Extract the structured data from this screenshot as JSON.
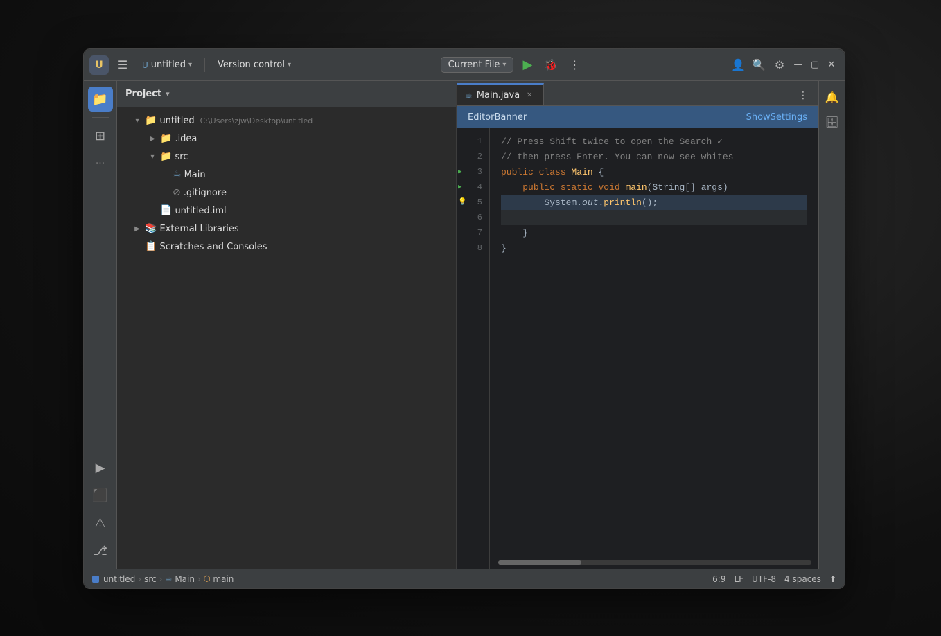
{
  "window": {
    "title": "untitled",
    "logo_letter": "U",
    "project_label": "untitled",
    "project_arrow": "▾",
    "vcs_label": "Version control",
    "vcs_arrow": "▾",
    "run_config_label": "Current File",
    "run_config_arrow": "▾"
  },
  "toolbar": {
    "icons": [
      "📁",
      "⊞",
      "···"
    ]
  },
  "panel": {
    "title": "Project",
    "title_arrow": "▾"
  },
  "file_tree": [
    {
      "indent": 1,
      "arrow": "▾",
      "icon": "📁",
      "icon_class": "folder",
      "name": "untitled",
      "path": "C:\\Users\\zjw\\Desktop\\untitled"
    },
    {
      "indent": 2,
      "arrow": "▶",
      "icon": "📁",
      "icon_class": "folder",
      "name": ".idea",
      "path": ""
    },
    {
      "indent": 2,
      "arrow": "▾",
      "icon": "📁",
      "icon_class": "folder",
      "name": "src",
      "path": ""
    },
    {
      "indent": 3,
      "arrow": "",
      "icon": "☕",
      "icon_class": "java",
      "name": "Main",
      "path": ""
    },
    {
      "indent": 3,
      "arrow": "",
      "icon": "⊘",
      "icon_class": "git",
      "name": ".gitignore",
      "path": ""
    },
    {
      "indent": 2,
      "arrow": "",
      "icon": "📄",
      "icon_class": "file",
      "name": "untitled.iml",
      "path": ""
    },
    {
      "indent": 1,
      "arrow": "▶",
      "icon": "📚",
      "icon_class": "folder",
      "name": "External Libraries",
      "path": ""
    },
    {
      "indent": 1,
      "arrow": "",
      "icon": "📋",
      "icon_class": "file",
      "name": "Scratches and Consoles",
      "path": ""
    }
  ],
  "editor": {
    "tab_name": "Main.java",
    "tab_icon": "☕",
    "banner_text": "EditorBanner",
    "banner_action": "ShowSettings",
    "code_lines": [
      {
        "num": "1",
        "indicator": null,
        "content": "// Press Shift twice to open the Search ✓ "
      },
      {
        "num": "2",
        "indicator": null,
        "content": "// then press Enter. You can now see whites"
      },
      {
        "num": "3",
        "indicator": "run",
        "content": "public class Main {"
      },
      {
        "num": "4",
        "indicator": "run",
        "content": "    public static void main(String[] args)"
      },
      {
        "num": "5",
        "indicator": "bulb",
        "content": "        System.out.println();"
      },
      {
        "num": "6",
        "indicator": null,
        "content": ""
      },
      {
        "num": "7",
        "indicator": null,
        "content": "    }"
      },
      {
        "num": "8",
        "indicator": null,
        "content": "}"
      }
    ]
  },
  "status_bar": {
    "breadcrumbs": [
      {
        "type": "plain",
        "label": "untitled"
      },
      {
        "type": "arrow",
        "label": "›"
      },
      {
        "type": "plain",
        "label": "src"
      },
      {
        "type": "arrow",
        "label": "›"
      },
      {
        "type": "java",
        "label": "Main"
      },
      {
        "type": "arrow",
        "label": "›"
      },
      {
        "type": "method",
        "label": "main"
      }
    ],
    "position": "6:9",
    "line_ending": "LF",
    "encoding": "UTF-8",
    "indent": "4 spaces"
  },
  "bottom_toolbar": [
    {
      "icon": "▶",
      "name": "run-icon"
    },
    {
      "icon": "⬛",
      "name": "terminal-icon"
    },
    {
      "icon": "⚠",
      "name": "problems-icon"
    },
    {
      "icon": "⎇",
      "name": "git-icon"
    }
  ]
}
